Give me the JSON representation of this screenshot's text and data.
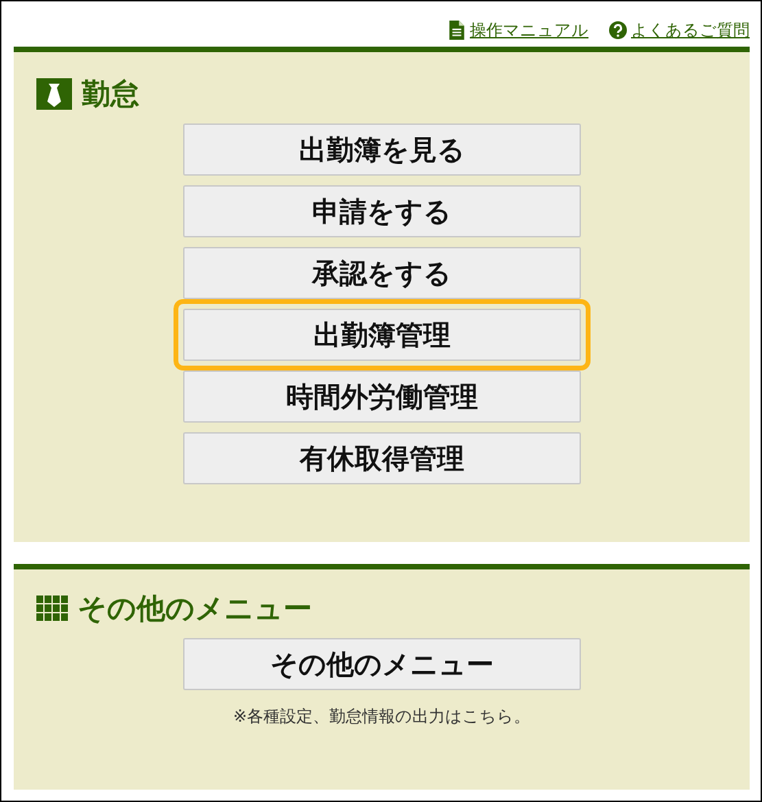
{
  "header_links": [
    {
      "kind": "document",
      "label": "操作マニュアル"
    },
    {
      "kind": "help",
      "label": "よくあるご質問"
    }
  ],
  "attendance": {
    "title": "勤怠",
    "buttons": [
      {
        "label": "出勤簿を見る",
        "highlighted": false
      },
      {
        "label": "申請をする",
        "highlighted": false
      },
      {
        "label": "承認をする",
        "highlighted": false
      },
      {
        "label": "出勤簿管理",
        "highlighted": true
      },
      {
        "label": "時間外労働管理",
        "highlighted": false
      },
      {
        "label": "有休取得管理",
        "highlighted": false
      }
    ]
  },
  "other": {
    "title": "その他のメニュー",
    "buttons": [
      {
        "label": "その他のメニュー",
        "highlighted": false
      }
    ],
    "note": "※各種設定、勤怠情報の出力はこちら。"
  }
}
